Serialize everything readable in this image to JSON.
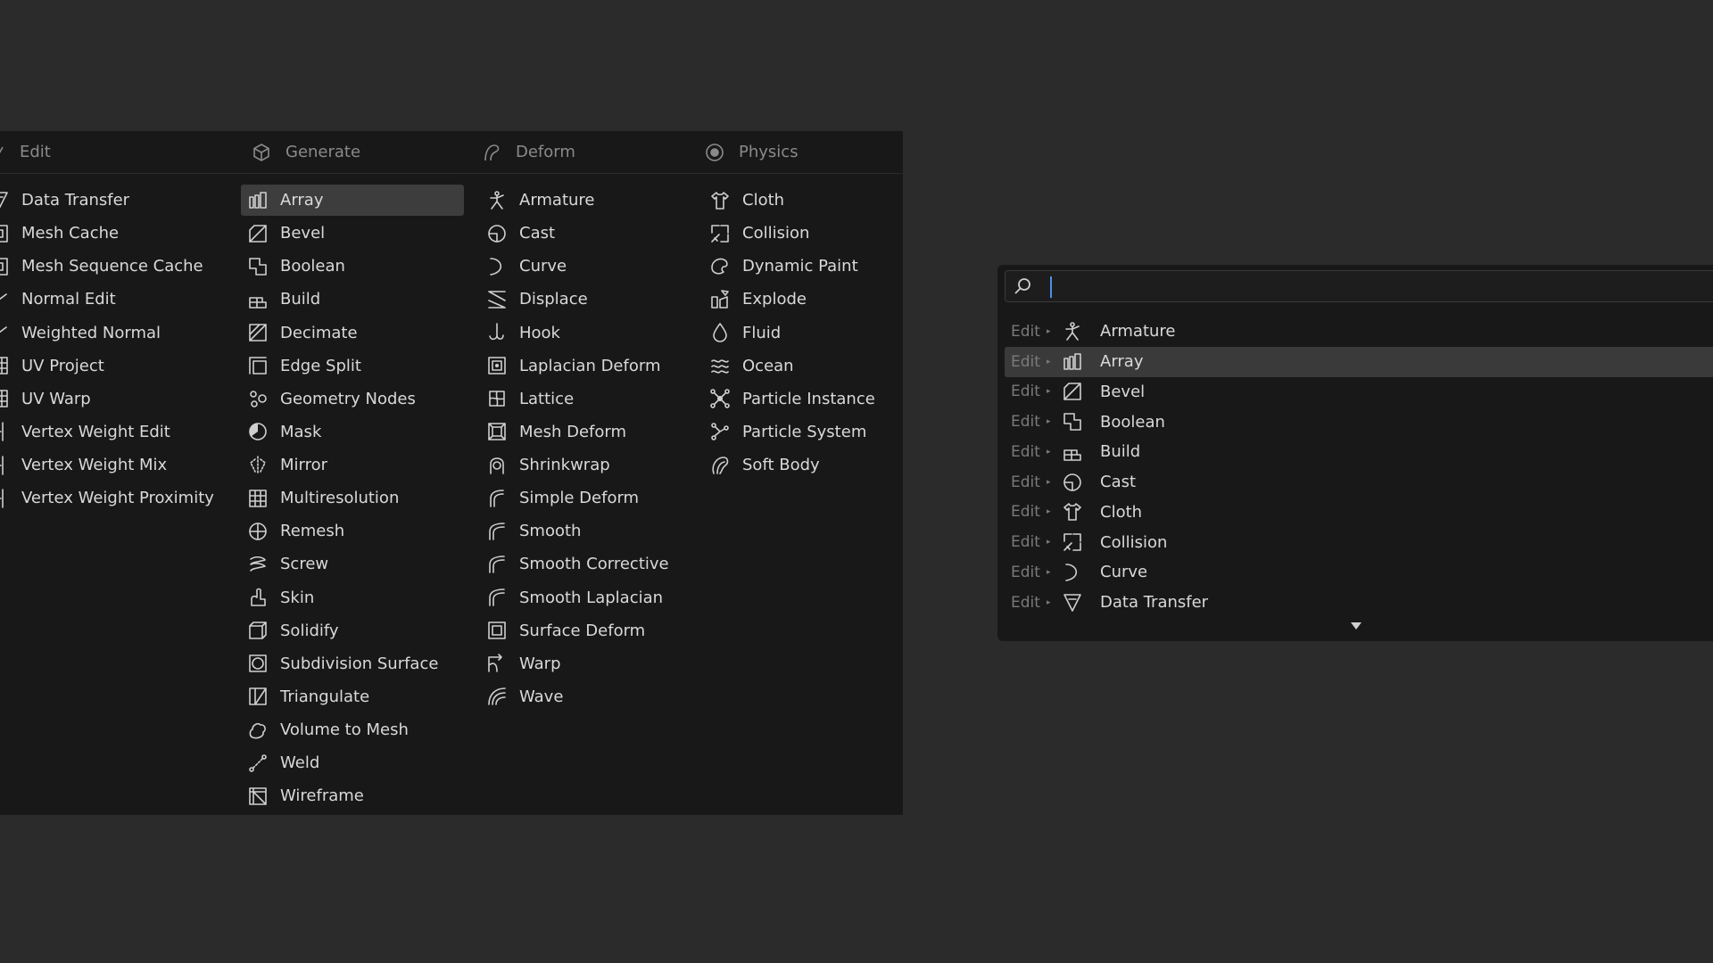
{
  "menu": {
    "columns": [
      {
        "header": {
          "label": "Edit",
          "icon": "edit-icon"
        },
        "items": [
          {
            "label": "Data Transfer",
            "icon": "data-transfer-icon"
          },
          {
            "label": "Mesh Cache",
            "icon": "mesh-cache-icon"
          },
          {
            "label": "Mesh Sequence Cache",
            "icon": "mesh-sequence-cache-icon"
          },
          {
            "label": "Normal Edit",
            "icon": "normal-edit-icon"
          },
          {
            "label": "Weighted Normal",
            "icon": "weighted-normal-icon"
          },
          {
            "label": "UV Project",
            "icon": "uv-project-icon"
          },
          {
            "label": "UV Warp",
            "icon": "uv-warp-icon"
          },
          {
            "label": "Vertex Weight Edit",
            "icon": "vertex-weight-edit-icon"
          },
          {
            "label": "Vertex Weight Mix",
            "icon": "vertex-weight-mix-icon"
          },
          {
            "label": "Vertex Weight Proximity",
            "icon": "vertex-weight-proximity-icon"
          }
        ]
      },
      {
        "header": {
          "label": "Generate",
          "icon": "cube-icon"
        },
        "items": [
          {
            "label": "Array",
            "icon": "array-icon"
          },
          {
            "label": "Bevel",
            "icon": "bevel-icon"
          },
          {
            "label": "Boolean",
            "icon": "boolean-icon"
          },
          {
            "label": "Build",
            "icon": "build-icon"
          },
          {
            "label": "Decimate",
            "icon": "decimate-icon"
          },
          {
            "label": "Edge Split",
            "icon": "edge-split-icon"
          },
          {
            "label": "Geometry Nodes",
            "icon": "geometry-nodes-icon"
          },
          {
            "label": "Mask",
            "icon": "mask-icon"
          },
          {
            "label": "Mirror",
            "icon": "mirror-icon"
          },
          {
            "label": "Multiresolution",
            "icon": "multiresolution-icon"
          },
          {
            "label": "Remesh",
            "icon": "remesh-icon"
          },
          {
            "label": "Screw",
            "icon": "screw-icon"
          },
          {
            "label": "Skin",
            "icon": "skin-icon"
          },
          {
            "label": "Solidify",
            "icon": "solidify-icon"
          },
          {
            "label": "Subdivision Surface",
            "icon": "subdivision-surface-icon"
          },
          {
            "label": "Triangulate",
            "icon": "triangulate-icon"
          },
          {
            "label": "Volume to Mesh",
            "icon": "volume-to-mesh-icon"
          },
          {
            "label": "Weld",
            "icon": "weld-icon"
          },
          {
            "label": "Wireframe",
            "icon": "wireframe-icon"
          }
        ]
      },
      {
        "header": {
          "label": "Deform",
          "icon": "deform-icon"
        },
        "items": [
          {
            "label": "Armature",
            "icon": "armature-icon"
          },
          {
            "label": "Cast",
            "icon": "cast-icon"
          },
          {
            "label": "Curve",
            "icon": "curve-icon"
          },
          {
            "label": "Displace",
            "icon": "displace-icon"
          },
          {
            "label": "Hook",
            "icon": "hook-icon"
          },
          {
            "label": "Laplacian Deform",
            "icon": "laplacian-deform-icon"
          },
          {
            "label": "Lattice",
            "icon": "lattice-icon"
          },
          {
            "label": "Mesh Deform",
            "icon": "mesh-deform-icon"
          },
          {
            "label": "Shrinkwrap",
            "icon": "shrinkwrap-icon"
          },
          {
            "label": "Simple Deform",
            "icon": "simple-deform-icon"
          },
          {
            "label": "Smooth",
            "icon": "smooth-icon"
          },
          {
            "label": "Smooth Corrective",
            "icon": "smooth-corrective-icon"
          },
          {
            "label": "Smooth Laplacian",
            "icon": "smooth-laplacian-icon"
          },
          {
            "label": "Surface Deform",
            "icon": "surface-deform-icon"
          },
          {
            "label": "Warp",
            "icon": "warp-icon"
          },
          {
            "label": "Wave",
            "icon": "wave-icon"
          }
        ]
      },
      {
        "header": {
          "label": "Physics",
          "icon": "physics-icon"
        },
        "items": [
          {
            "label": "Cloth",
            "icon": "cloth-icon"
          },
          {
            "label": "Collision",
            "icon": "collision-icon"
          },
          {
            "label": "Dynamic Paint",
            "icon": "dynamic-paint-icon"
          },
          {
            "label": "Explode",
            "icon": "explode-icon"
          },
          {
            "label": "Fluid",
            "icon": "fluid-icon"
          },
          {
            "label": "Ocean",
            "icon": "ocean-icon"
          },
          {
            "label": "Particle Instance",
            "icon": "particle-instance-icon"
          },
          {
            "label": "Particle System",
            "icon": "particle-system-icon"
          },
          {
            "label": "Soft Body",
            "icon": "soft-body-icon"
          }
        ]
      }
    ],
    "highlighted": "Array"
  },
  "search": {
    "query": "",
    "results": [
      {
        "crumb": "Edit",
        "label": "Armature",
        "icon": "armature-icon"
      },
      {
        "crumb": "Edit",
        "label": "Array",
        "icon": "array-icon",
        "highlighted": true
      },
      {
        "crumb": "Edit",
        "label": "Bevel",
        "icon": "bevel-icon"
      },
      {
        "crumb": "Edit",
        "label": "Boolean",
        "icon": "boolean-icon"
      },
      {
        "crumb": "Edit",
        "label": "Build",
        "icon": "build-icon"
      },
      {
        "crumb": "Edit",
        "label": "Cast",
        "icon": "cast-icon"
      },
      {
        "crumb": "Edit",
        "label": "Cloth",
        "icon": "cloth-icon"
      },
      {
        "crumb": "Edit",
        "label": "Collision",
        "icon": "collision-icon"
      },
      {
        "crumb": "Edit",
        "label": "Curve",
        "icon": "curve-icon"
      },
      {
        "crumb": "Edit",
        "label": "Data Transfer",
        "icon": "data-transfer-icon"
      }
    ]
  },
  "colors": {
    "background": "#2b2b2b",
    "panel": "#181818",
    "highlight": "#3d3d3d",
    "caret": "#4e8fe6",
    "text": "#d9d9d9",
    "muted": "#8a8a8a"
  }
}
